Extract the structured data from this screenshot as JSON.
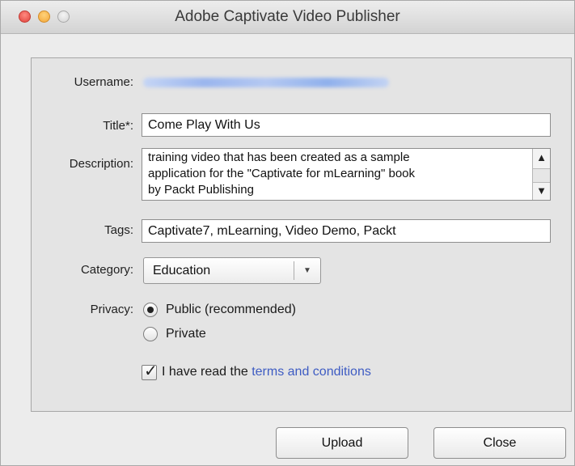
{
  "window": {
    "title": "Adobe Captivate Video Publisher"
  },
  "form": {
    "username_label": "Username:",
    "title_label": "Title*:",
    "title_value": "Come Play With Us",
    "description_label": "Description:",
    "description_lines": [
      "training video that has been created as a sample",
      "application for the \"Captivate for mLearning\" book",
      "by Packt Publishing"
    ],
    "tags_label": "Tags:",
    "tags_value": "Captivate7, mLearning, Video Demo, Packt",
    "category_label": "Category:",
    "category_value": "Education",
    "privacy_label": "Privacy:",
    "privacy_options": [
      {
        "label": "Public (recommended)",
        "selected": true
      },
      {
        "label": "Private",
        "selected": false
      }
    ],
    "terms_prefix": "I have read the",
    "terms_link": "terms and conditions",
    "terms_checked": true
  },
  "buttons": {
    "upload": "Upload",
    "close": "Close"
  },
  "icons": {
    "scroll_up": "▲",
    "scroll_down": "▼",
    "dropdown": "▼",
    "check": "✓"
  },
  "colors": {
    "link": "#3e5cc3",
    "close_light": "#e0443e",
    "minimize_light": "#f3a73a"
  }
}
